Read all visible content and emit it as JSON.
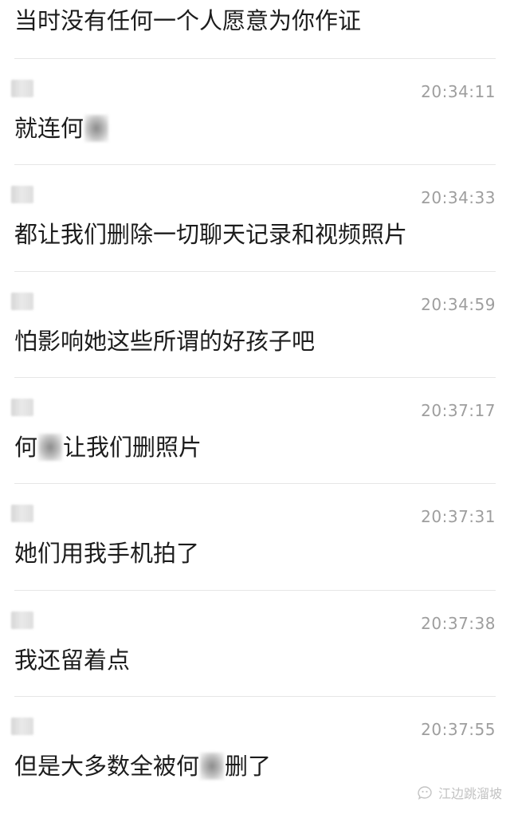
{
  "header_text": "当时没有任何一个人愿意为你作证",
  "messages": [
    {
      "time": "20:34:11",
      "parts": [
        "就连何",
        "#redact"
      ]
    },
    {
      "time": "20:34:33",
      "parts": [
        "都让我们删除一切聊天记录和视频照片"
      ]
    },
    {
      "time": "20:34:59",
      "parts": [
        "怕影响她这些所谓的好孩子吧"
      ]
    },
    {
      "time": "20:37:17",
      "parts": [
        "何",
        "#redact",
        "让我们删照片"
      ]
    },
    {
      "time": "20:37:31",
      "parts": [
        "她们用我手机拍了"
      ]
    },
    {
      "time": "20:37:38",
      "parts": [
        "我还留着点"
      ]
    },
    {
      "time": "20:37:55",
      "parts": [
        "但是大多数全被何",
        "#redact",
        "删了"
      ]
    }
  ],
  "watermark": {
    "icon": "wechat-official-account-icon",
    "label": "江边跳溜坡"
  }
}
